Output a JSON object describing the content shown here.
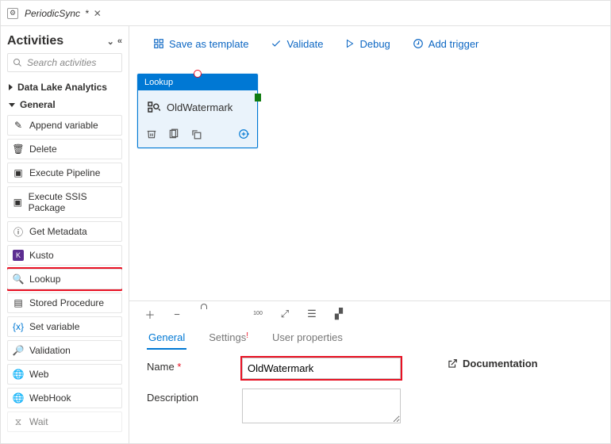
{
  "tab": {
    "title": "PeriodicSync",
    "dirty_mark": "*"
  },
  "sidebar": {
    "title": "Activities",
    "search_placeholder": "Search activities",
    "groups": [
      {
        "label": "Data Lake Analytics"
      },
      {
        "label": "General"
      }
    ],
    "items": [
      {
        "label": "Append variable"
      },
      {
        "label": "Delete"
      },
      {
        "label": "Execute Pipeline"
      },
      {
        "label": "Execute SSIS Package"
      },
      {
        "label": "Get Metadata"
      },
      {
        "label": "Kusto"
      },
      {
        "label": "Lookup"
      },
      {
        "label": "Stored Procedure"
      },
      {
        "label": "Set variable"
      },
      {
        "label": "Validation"
      },
      {
        "label": "Web"
      },
      {
        "label": "WebHook"
      },
      {
        "label": "Wait"
      }
    ]
  },
  "toolbar": {
    "save_template": "Save as template",
    "validate": "Validate",
    "debug": "Debug",
    "add_trigger": "Add trigger"
  },
  "node": {
    "type_label": "Lookup",
    "title": "OldWatermark"
  },
  "props": {
    "tabs": {
      "general": "General",
      "settings": "Settings",
      "user_props": "User properties"
    },
    "name_label": "Name",
    "name_value": "OldWatermark",
    "desc_label": "Description",
    "doc_label": "Documentation"
  }
}
